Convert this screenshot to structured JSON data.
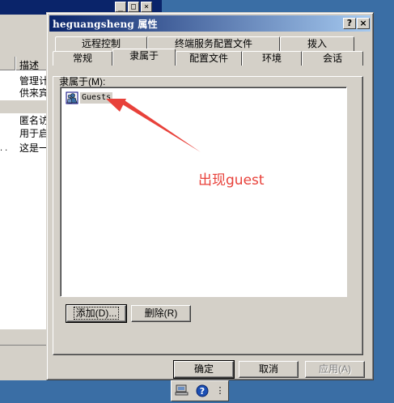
{
  "background_window": {
    "column_header": "描述",
    "rows": [
      "管理计",
      "供来宾",
      "匿名访",
      "用于启",
      "这是一"
    ]
  },
  "dialog": {
    "title": "heguangsheng 属性",
    "help_label": "?",
    "close_label": "×",
    "tabs_row1": [
      "远程控制",
      "终端服务配置文件",
      "拨入"
    ],
    "tabs_row2": [
      "常规",
      "隶属于",
      "配置文件",
      "环境",
      "会话"
    ],
    "active_tab": "隶属于",
    "member_of_label": "隶属于(M):",
    "groups": [
      "Guests"
    ],
    "add_button": "添加(D)...",
    "remove_button": "删除(R)",
    "ok_button": "确定",
    "cancel_button": "取消",
    "apply_button": "应用(A)"
  },
  "annotation": {
    "text": "出现guest",
    "color": "#e8413a"
  },
  "colors": {
    "desktop": "#3a6ea5",
    "titlebar_start": "#0a246a",
    "titlebar_end": "#a6caf0",
    "face": "#d4d0c8"
  },
  "bottom_toolbar": {
    "help_icon_label": "?"
  }
}
